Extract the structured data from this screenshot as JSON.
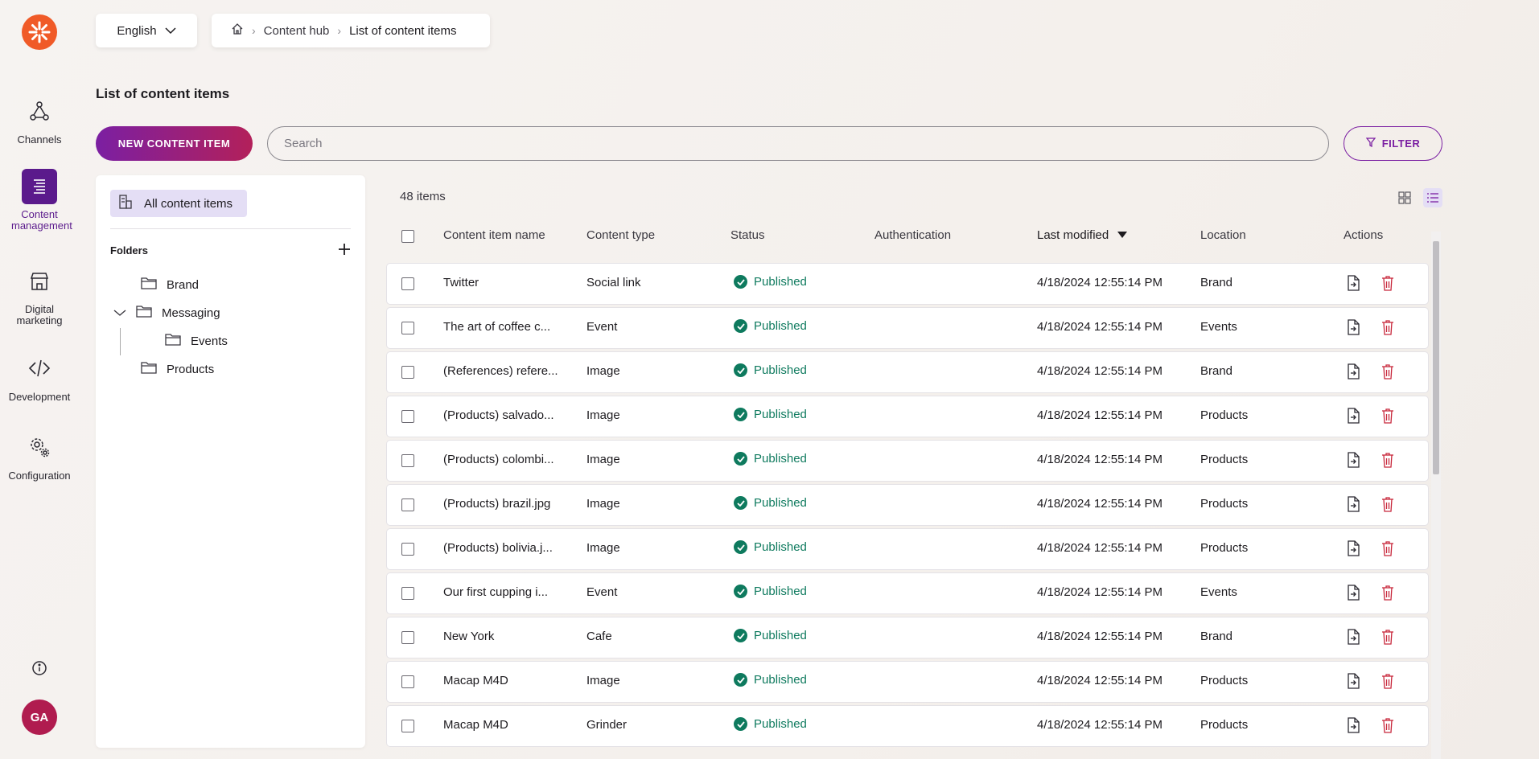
{
  "app": {
    "nav": [
      {
        "label": "Channels",
        "icon": "channels-icon"
      },
      {
        "label": "Content management",
        "icon": "content-management-icon",
        "active": true
      },
      {
        "label": "Digital marketing",
        "icon": "store-icon"
      },
      {
        "label": "Development",
        "icon": "code-icon"
      },
      {
        "label": "Configuration",
        "icon": "gear-icon"
      }
    ],
    "avatar_initials": "GA",
    "brand_color": "#f05a28"
  },
  "header": {
    "language": "English",
    "breadcrumb": [
      "Content hub",
      "List of content items"
    ]
  },
  "page": {
    "title": "List of content items",
    "new_button": "NEW CONTENT ITEM",
    "search_placeholder": "Search",
    "filter_button": "FILTER"
  },
  "folders": {
    "all_items_label": "All content items",
    "heading": "Folders",
    "tree": [
      {
        "label": "Brand",
        "level": 0
      },
      {
        "label": "Messaging",
        "level": 0,
        "expanded": true
      },
      {
        "label": "Events",
        "level": 1
      },
      {
        "label": "Products",
        "level": 0
      }
    ]
  },
  "table": {
    "count": "48 items",
    "columns": [
      "Content item name",
      "Content type",
      "Status",
      "Authentication",
      "Last modified",
      "Location",
      "Actions"
    ],
    "sorted_column": "Last modified",
    "rows": [
      {
        "name": "Twitter",
        "type": "Social link",
        "status": "Published",
        "auth": "",
        "modified": "4/18/2024 12:55:14 PM",
        "location": "Brand"
      },
      {
        "name": "The art of coffee c...",
        "type": "Event",
        "status": "Published",
        "auth": "",
        "modified": "4/18/2024 12:55:14 PM",
        "location": "Events"
      },
      {
        "name": "(References) refere...",
        "type": "Image",
        "status": "Published",
        "auth": "",
        "modified": "4/18/2024 12:55:14 PM",
        "location": "Brand"
      },
      {
        "name": "(Products) salvado...",
        "type": "Image",
        "status": "Published",
        "auth": "",
        "modified": "4/18/2024 12:55:14 PM",
        "location": "Products"
      },
      {
        "name": "(Products) colombi...",
        "type": "Image",
        "status": "Published",
        "auth": "",
        "modified": "4/18/2024 12:55:14 PM",
        "location": "Products"
      },
      {
        "name": "(Products) brazil.jpg",
        "type": "Image",
        "status": "Published",
        "auth": "",
        "modified": "4/18/2024 12:55:14 PM",
        "location": "Products"
      },
      {
        "name": "(Products) bolivia.j...",
        "type": "Image",
        "status": "Published",
        "auth": "",
        "modified": "4/18/2024 12:55:14 PM",
        "location": "Products"
      },
      {
        "name": "Our first cupping i...",
        "type": "Event",
        "status": "Published",
        "auth": "",
        "modified": "4/18/2024 12:55:14 PM",
        "location": "Events"
      },
      {
        "name": "New York",
        "type": "Cafe",
        "status": "Published",
        "auth": "",
        "modified": "4/18/2024 12:55:14 PM",
        "location": "Brand"
      },
      {
        "name": "Macap M4D",
        "type": "Image",
        "status": "Published",
        "auth": "",
        "modified": "4/18/2024 12:55:14 PM",
        "location": "Products"
      },
      {
        "name": "Macap M4D",
        "type": "Grinder",
        "status": "Published",
        "auth": "",
        "modified": "4/18/2024 12:55:14 PM",
        "location": "Products"
      }
    ],
    "status_color": "#0e7a5e",
    "delete_color": "#c8283c"
  }
}
